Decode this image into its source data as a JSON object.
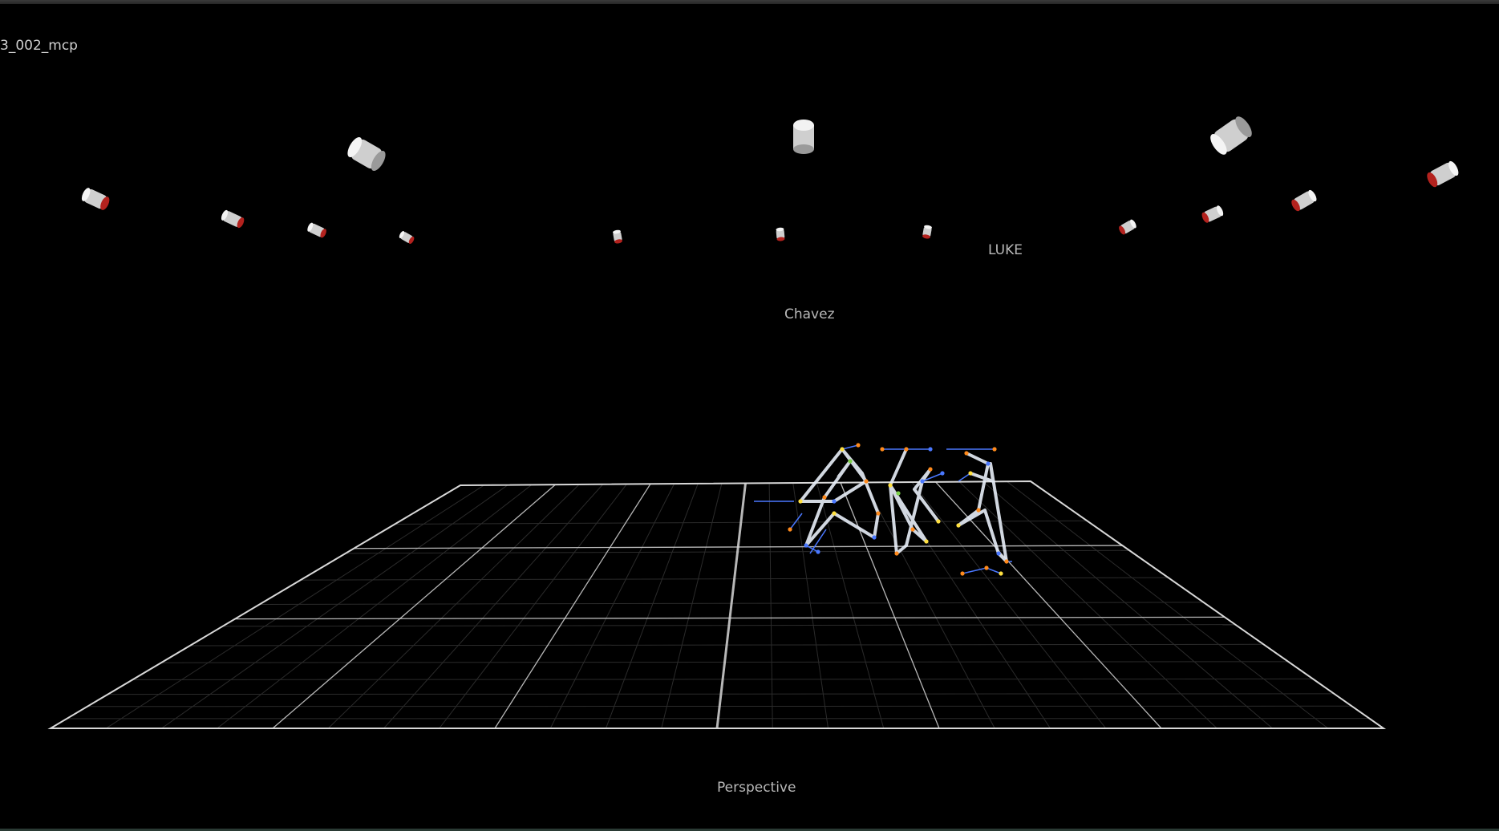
{
  "viewport": {
    "take_name": "3_002_mcp",
    "camera_label": "Perspective"
  },
  "actors": [
    {
      "name": "LUKE"
    },
    {
      "name": "Chavez"
    }
  ],
  "cameras": {
    "large_count": 3,
    "small_count": 12,
    "body_color": "#cfcfcf",
    "lens_color": "#b3221e"
  },
  "grid": {
    "line_color": "#d8d8d8",
    "subgrid_color": "#2b2b2b"
  },
  "skeleton_colors": {
    "bone": "#e8eef8",
    "joint_blue": "#4a78ff",
    "joint_orange": "#ff8a1c",
    "joint_yellow": "#ffe040",
    "joint_green": "#7cd04a"
  }
}
